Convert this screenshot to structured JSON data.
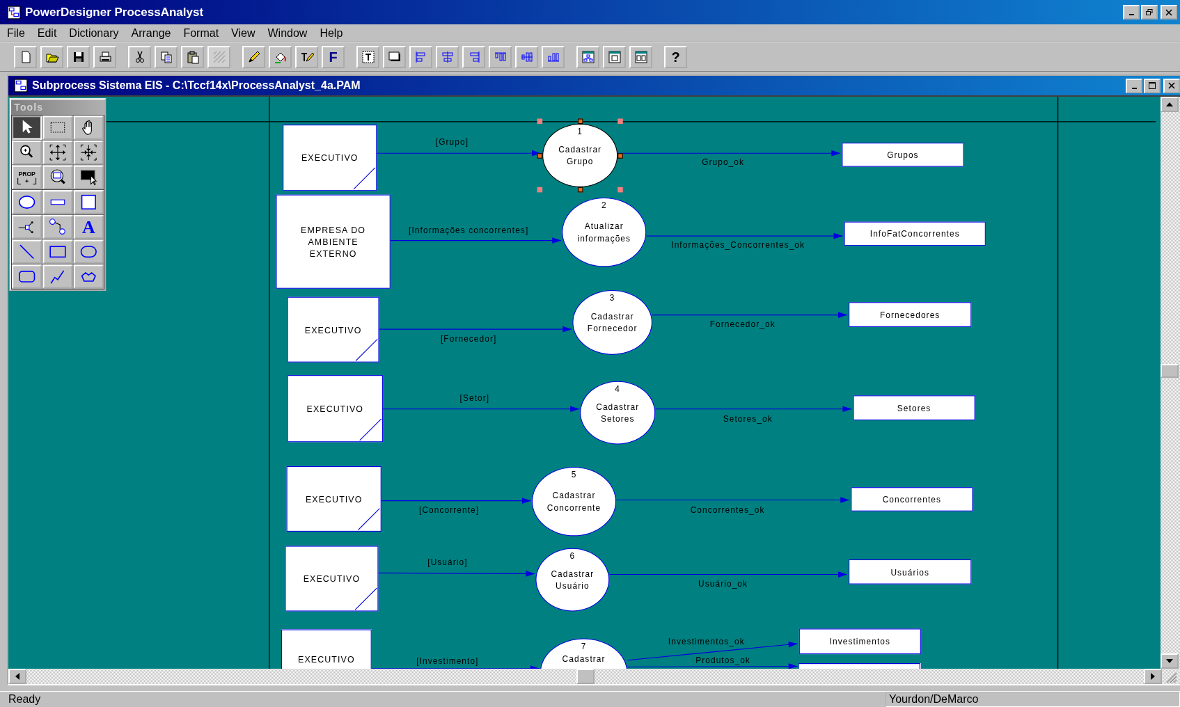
{
  "window": {
    "title": "PowerDesigner ProcessAnalyst"
  },
  "menu": [
    {
      "label": "File"
    },
    {
      "label": "Edit"
    },
    {
      "label": "Dictionary"
    },
    {
      "label": "Arrange"
    },
    {
      "label": "Format"
    },
    {
      "label": "View"
    },
    {
      "label": "Window"
    },
    {
      "label": "Help"
    }
  ],
  "toolbar": {
    "groups": [
      {
        "buttons": [
          {
            "kind": "new",
            "disabled": false
          },
          {
            "kind": "open",
            "disabled": false
          },
          {
            "kind": "save",
            "disabled": false
          },
          {
            "kind": "print",
            "disabled": false
          }
        ]
      },
      {
        "buttons": [
          {
            "kind": "cut",
            "disabled": false
          },
          {
            "kind": "copy",
            "disabled": false
          },
          {
            "kind": "paste",
            "disabled": false
          },
          {
            "kind": "hatch",
            "disabled": true
          }
        ]
      },
      {
        "buttons": [
          {
            "kind": "pencil",
            "disabled": false
          },
          {
            "kind": "bucket",
            "disabled": false
          },
          {
            "kind": "textpen",
            "disabled": false
          },
          {
            "kind": "font",
            "label": "F",
            "disabled": false
          }
        ]
      },
      {
        "buttons": [
          {
            "kind": "textframe",
            "disabled": false
          },
          {
            "kind": "shadow",
            "disabled": false
          },
          {
            "kind": "alignleft",
            "disabled": false
          },
          {
            "kind": "aligncenter",
            "disabled": false
          },
          {
            "kind": "alignright",
            "disabled": false
          },
          {
            "kind": "aligntop",
            "disabled": false
          },
          {
            "kind": "alignmiddle",
            "disabled": false
          },
          {
            "kind": "alignbottom",
            "disabled": false
          }
        ]
      },
      {
        "buttons": [
          {
            "kind": "tree",
            "disabled": false
          },
          {
            "kind": "window",
            "disabled": false
          },
          {
            "kind": "split",
            "disabled": false
          }
        ]
      },
      {
        "buttons": [
          {
            "kind": "help",
            "label": "?",
            "disabled": false
          }
        ]
      }
    ]
  },
  "document": {
    "title": "Subprocess Sistema EIS - C:\\Tccf14x\\ProcessAnalyst_4a.PAM"
  },
  "tools_palette": {
    "title": "Tools",
    "tools": [
      {
        "kind": "pointer",
        "selected": true
      },
      {
        "kind": "marquee",
        "selected": false
      },
      {
        "kind": "hand",
        "selected": false
      },
      {
        "kind": "zoom",
        "selected": false
      },
      {
        "kind": "expand",
        "selected": false
      },
      {
        "kind": "contract",
        "selected": false
      },
      {
        "kind": "prop",
        "label": "PROP",
        "selected": false
      },
      {
        "kind": "zoomwindow",
        "selected": false
      },
      {
        "kind": "monitor",
        "selected": false
      },
      {
        "kind": "process",
        "selected": false
      },
      {
        "kind": "store",
        "selected": false
      },
      {
        "kind": "entity",
        "selected": false
      },
      {
        "kind": "split",
        "selected": false
      },
      {
        "kind": "flow",
        "selected": false
      },
      {
        "kind": "text",
        "label": "A",
        "selected": false
      },
      {
        "kind": "line",
        "selected": false
      },
      {
        "kind": "rect",
        "selected": false
      },
      {
        "kind": "oval",
        "selected": false
      },
      {
        "kind": "roundrect",
        "selected": false
      },
      {
        "kind": "polyline",
        "selected": false
      },
      {
        "kind": "polygon",
        "selected": false
      }
    ]
  },
  "diagram": {
    "rows": [
      {
        "entity": "EXECUTIVO",
        "shortcut_mark": true,
        "input_flow": "[Grupo]",
        "process_number": "1",
        "process_name": "Cadastrar Grupo",
        "selected": true,
        "outputs": [
          {
            "flow": "Grupo_ok",
            "store": "Grupos"
          }
        ]
      },
      {
        "entity": "EMPRESA DO AMBIENTE EXTERNO",
        "shortcut_mark": false,
        "input_flow": "[Informações concorrentes]",
        "process_number": "2",
        "process_name": "Atualizar informações",
        "selected": false,
        "outputs": [
          {
            "flow": "Informações_Concorrentes_ok",
            "store": "InfoFatConcorrentes"
          }
        ]
      },
      {
        "entity": "EXECUTIVO",
        "shortcut_mark": true,
        "input_flow": "[Fornecedor]",
        "process_number": "3",
        "process_name": "Cadastrar Fornecedor",
        "selected": false,
        "outputs": [
          {
            "flow": "Fornecedor_ok",
            "store": "Fornecedores"
          }
        ]
      },
      {
        "entity": "EXECUTIVO",
        "shortcut_mark": true,
        "input_flow": "[Setor]",
        "process_number": "4",
        "process_name": "Cadastrar Setores",
        "selected": false,
        "outputs": [
          {
            "flow": "Setores_ok",
            "store": "Setores"
          }
        ]
      },
      {
        "entity": "EXECUTIVO",
        "shortcut_mark": true,
        "input_flow": "[Concorrente]",
        "process_number": "5",
        "process_name": "Cadastrar Concorrente",
        "selected": false,
        "outputs": [
          {
            "flow": "Concorrentes_ok",
            "store": "Concorrentes"
          }
        ]
      },
      {
        "entity": "EXECUTIVO",
        "shortcut_mark": true,
        "input_flow": "[Usuário]",
        "process_number": "6",
        "process_name": "Cadastrar Usuário",
        "selected": false,
        "outputs": [
          {
            "flow": "Usuário_ok",
            "store": "Usuários"
          }
        ]
      },
      {
        "entity": "EXECUTIVO",
        "shortcut_mark": false,
        "input_flow": "[Investimento]",
        "process_number": "7",
        "process_name": "Cadastrar",
        "selected": false,
        "outputs": [
          {
            "flow": "Investimentos_ok",
            "store": "Investimentos"
          },
          {
            "flow": "Produtos_ok"
          }
        ]
      }
    ]
  },
  "status_bar": {
    "message": "Ready",
    "methodology": "Yourdon/DeMarco"
  }
}
